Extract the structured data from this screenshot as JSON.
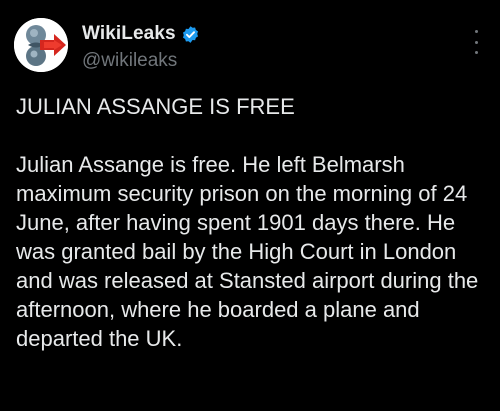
{
  "author": {
    "display_name": "WikiLeaks",
    "handle": "@wikileaks",
    "verified": true,
    "avatar_icon": "wikileaks-logo-icon",
    "verified_icon": "verified-badge-icon",
    "verified_color": "#1d9bf0"
  },
  "menu": {
    "icon": "more-options-icon"
  },
  "tweet": {
    "headline": "JULIAN ASSANGE IS FREE",
    "body": "Julian Assange is free. He left Belmarsh maximum security prison on the morning of 24 June, after having spent 1901 days there. He was granted bail by the High Court in London and was released at Stansted airport during the afternoon, where he boarded a plane and departed the UK."
  },
  "colors": {
    "background": "#000000",
    "text": "#e7e9ea",
    "secondary_text": "#71767b"
  }
}
